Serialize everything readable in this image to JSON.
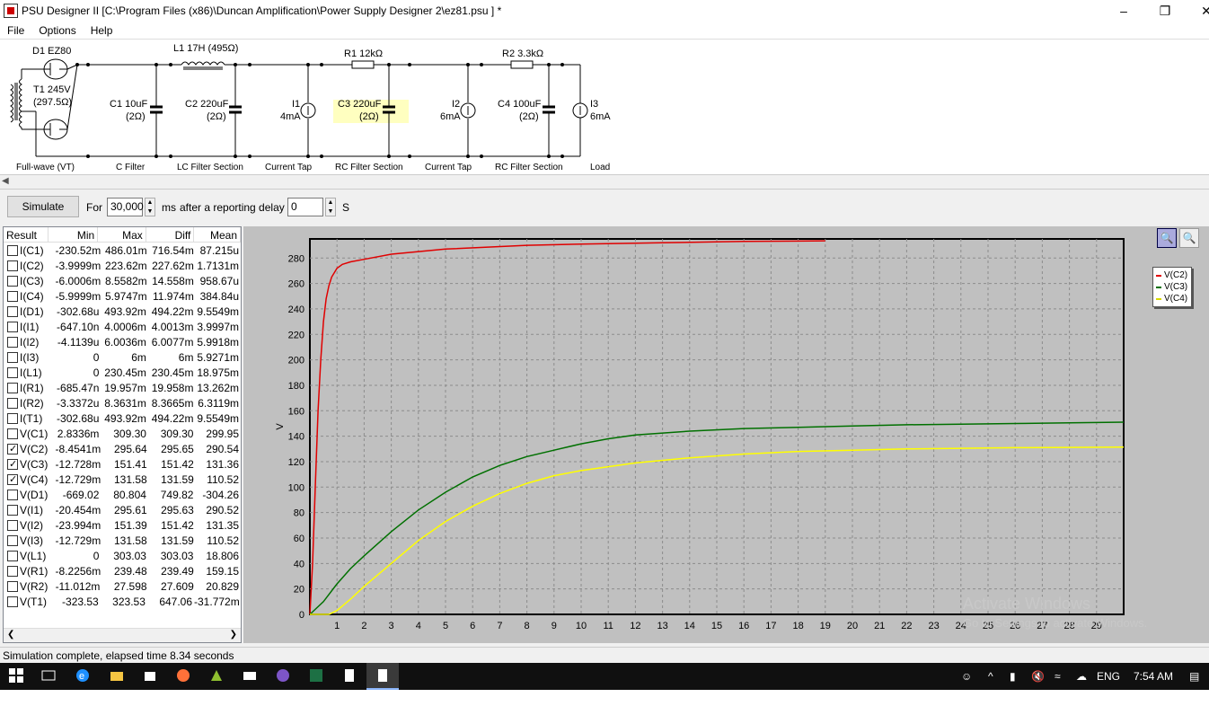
{
  "window": {
    "title": "PSU Designer II  [C:\\Program Files (x86)\\Duncan Amplification\\Power Supply Designer 2\\ez81.psu ] *"
  },
  "menu": [
    "File",
    "Options",
    "Help"
  ],
  "schematic": {
    "components": {
      "d1": "D1 EZ80",
      "t1a": "T1 245V",
      "t1b": "(297.5Ω)",
      "l1": "L1 17H (495Ω)",
      "r1": "R1 12kΩ",
      "r2": "R2 3.3kΩ",
      "c1a": "C1 10uF",
      "c1b": "(2Ω)",
      "c2a": "C2 220uF",
      "c2b": "(2Ω)",
      "i1a": "I1",
      "i1b": "4mA",
      "c3a": "C3 220uF",
      "c3b": "(2Ω)",
      "i2a": "I2",
      "i2b": "6mA",
      "c4a": "C4 100uF",
      "c4b": "(2Ω)",
      "i3a": "I3",
      "i3b": "6mA"
    },
    "sections": [
      "Full-wave (VT)",
      "C Filter",
      "LC Filter Section",
      "Current Tap",
      "RC Filter Section",
      "Current Tap",
      "RC Filter Section",
      "Load"
    ]
  },
  "toolbar": {
    "simulate_label": "Simulate",
    "for_label": "For",
    "duration_value": "30,000",
    "ms_label": "ms",
    "delay_label": "after a reporting delay of",
    "delay_value": "0",
    "s_label": "S"
  },
  "results": {
    "columns": [
      "Result",
      "Min",
      "Max",
      "Diff",
      "Mean"
    ],
    "rows": [
      {
        "name": "I(C1)",
        "checked": false,
        "min": "-230.52m",
        "max": "486.01m",
        "diff": "716.54m",
        "mean": "87.215u"
      },
      {
        "name": "I(C2)",
        "checked": false,
        "min": "-3.9999m",
        "max": "223.62m",
        "diff": "227.62m",
        "mean": "1.7131m"
      },
      {
        "name": "I(C3)",
        "checked": false,
        "min": "-6.0006m",
        "max": "8.5582m",
        "diff": "14.558m",
        "mean": "958.67u"
      },
      {
        "name": "I(C4)",
        "checked": false,
        "min": "-5.9999m",
        "max": "5.9747m",
        "diff": "11.974m",
        "mean": "384.84u"
      },
      {
        "name": "I(D1)",
        "checked": false,
        "min": "-302.68u",
        "max": "493.92m",
        "diff": "494.22m",
        "mean": "9.5549m"
      },
      {
        "name": "I(I1)",
        "checked": false,
        "min": "-647.10n",
        "max": "4.0006m",
        "diff": "4.0013m",
        "mean": "3.9997m"
      },
      {
        "name": "I(I2)",
        "checked": false,
        "min": "-4.1139u",
        "max": "6.0036m",
        "diff": "6.0077m",
        "mean": "5.9918m"
      },
      {
        "name": "I(I3)",
        "checked": false,
        "min": "0",
        "max": "6m",
        "diff": "6m",
        "mean": "5.9271m"
      },
      {
        "name": "I(L1)",
        "checked": false,
        "min": "0",
        "max": "230.45m",
        "diff": "230.45m",
        "mean": "18.975m"
      },
      {
        "name": "I(R1)",
        "checked": false,
        "min": "-685.47n",
        "max": "19.957m",
        "diff": "19.958m",
        "mean": "13.262m"
      },
      {
        "name": "I(R2)",
        "checked": false,
        "min": "-3.3372u",
        "max": "8.3631m",
        "diff": "8.3665m",
        "mean": "6.3119m"
      },
      {
        "name": "I(T1)",
        "checked": false,
        "min": "-302.68u",
        "max": "493.92m",
        "diff": "494.22m",
        "mean": "9.5549m"
      },
      {
        "name": "V(C1)",
        "checked": false,
        "min": "2.8336m",
        "max": "309.30",
        "diff": "309.30",
        "mean": "299.95"
      },
      {
        "name": "V(C2)",
        "checked": true,
        "min": "-8.4541m",
        "max": "295.64",
        "diff": "295.65",
        "mean": "290.54"
      },
      {
        "name": "V(C3)",
        "checked": true,
        "min": "-12.728m",
        "max": "151.41",
        "diff": "151.42",
        "mean": "131.36"
      },
      {
        "name": "V(C4)",
        "checked": true,
        "min": "-12.729m",
        "max": "131.58",
        "diff": "131.59",
        "mean": "110.52"
      },
      {
        "name": "V(D1)",
        "checked": false,
        "min": "-669.02",
        "max": "80.804",
        "diff": "749.82",
        "mean": "-304.26"
      },
      {
        "name": "V(I1)",
        "checked": false,
        "min": "-20.454m",
        "max": "295.61",
        "diff": "295.63",
        "mean": "290.52"
      },
      {
        "name": "V(I2)",
        "checked": false,
        "min": "-23.994m",
        "max": "151.39",
        "diff": "151.42",
        "mean": "131.35"
      },
      {
        "name": "V(I3)",
        "checked": false,
        "min": "-12.729m",
        "max": "131.58",
        "diff": "131.59",
        "mean": "110.52"
      },
      {
        "name": "V(L1)",
        "checked": false,
        "min": "0",
        "max": "303.03",
        "diff": "303.03",
        "mean": "18.806"
      },
      {
        "name": "V(R1)",
        "checked": false,
        "min": "-8.2256m",
        "max": "239.48",
        "diff": "239.49",
        "mean": "159.15"
      },
      {
        "name": "V(R2)",
        "checked": false,
        "min": "-11.012m",
        "max": "27.598",
        "diff": "27.609",
        "mean": "20.829"
      },
      {
        "name": "V(T1)",
        "checked": false,
        "min": "-323.53",
        "max": "323.53",
        "diff": "647.06",
        "mean": "-31.772m"
      }
    ]
  },
  "chart_data": {
    "type": "line",
    "ylabel": "V",
    "xlim": [
      0,
      30
    ],
    "ylim": [
      0,
      295
    ],
    "xticks": [
      1,
      2,
      3,
      4,
      5,
      6,
      7,
      8,
      9,
      10,
      11,
      12,
      13,
      14,
      15,
      16,
      17,
      18,
      19,
      20,
      21,
      22,
      23,
      24,
      25,
      26,
      27,
      28,
      29
    ],
    "yticks": [
      0,
      20,
      40,
      60,
      80,
      100,
      120,
      140,
      160,
      180,
      200,
      220,
      240,
      260,
      280
    ],
    "grid": true,
    "legend_position": "right",
    "series": [
      {
        "name": "V(C2)",
        "color": "#e00000",
        "x": [
          0,
          0.1,
          0.2,
          0.3,
          0.4,
          0.5,
          0.6,
          0.7,
          0.8,
          1,
          1.2,
          1.5,
          2,
          3,
          5,
          8,
          10,
          13,
          16,
          19
        ],
        "y": [
          0,
          40,
          100,
          160,
          200,
          230,
          248,
          258,
          265,
          272,
          275,
          277,
          279,
          283,
          287,
          290,
          291,
          292,
          293,
          293.5
        ]
      },
      {
        "name": "V(C3)",
        "color": "#007000",
        "x": [
          0,
          0.5,
          1,
          1.5,
          2,
          3,
          4,
          5,
          6,
          7,
          8,
          9,
          10,
          11,
          12,
          14,
          16,
          18,
          20,
          22,
          24,
          26,
          28,
          30
        ],
        "y": [
          0,
          10,
          24,
          36,
          46,
          65,
          82,
          96,
          108,
          117,
          124,
          129,
          134,
          138,
          141,
          144,
          146,
          147,
          148,
          149,
          149.5,
          150,
          150.5,
          151
        ]
      },
      {
        "name": "V(C4)",
        "color": "#ffff00",
        "x": [
          0,
          0.7,
          1,
          1.5,
          2,
          3,
          4,
          5,
          6,
          7,
          8,
          9,
          10,
          11,
          12,
          14,
          16,
          18,
          20,
          22,
          24,
          26,
          28,
          30
        ],
        "y": [
          0,
          0,
          3,
          12,
          22,
          40,
          58,
          73,
          85,
          95,
          103,
          109,
          113,
          116,
          119,
          123,
          126,
          128,
          129,
          130,
          130.5,
          131,
          131.2,
          131.5
        ]
      }
    ]
  },
  "legend": [
    "V(C2)",
    "V(C3)",
    "V(C4)"
  ],
  "watermark": {
    "line1": "Activate Windows",
    "line2": "Go to Settings to activate Windows."
  },
  "status": "Simulation complete, elapsed time 8.34 seconds",
  "taskbar": {
    "language": "ENG",
    "time": "7:54 AM"
  }
}
